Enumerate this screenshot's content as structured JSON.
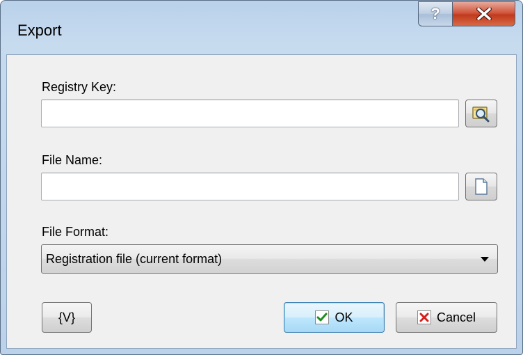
{
  "window": {
    "title": "Export",
    "help_label": "?",
    "close_label": "✕"
  },
  "fields": {
    "registry_key": {
      "label": "Registry Key:",
      "value": "",
      "browse_icon": "browse-magnifier-icon"
    },
    "file_name": {
      "label": "File Name:",
      "value": "",
      "browse_icon": "document-icon"
    },
    "file_format": {
      "label": "File Format:",
      "selected": "Registration file (current format)"
    }
  },
  "buttons": {
    "variables_label": "{V}",
    "ok_label": "OK",
    "ok_icon": "checkmark-icon",
    "cancel_label": "Cancel",
    "cancel_icon": "x-icon"
  },
  "colors": {
    "ok_check": "#1e8c1e",
    "cancel_x": "#d42020",
    "close_button": "#c9452a",
    "default_button_border": "#3c7fb1"
  }
}
